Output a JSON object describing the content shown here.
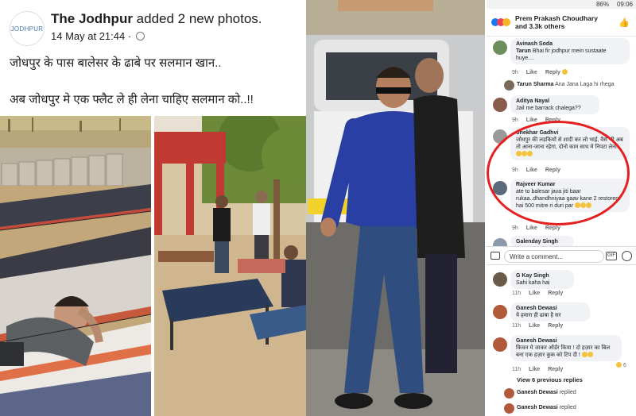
{
  "post": {
    "logo_text": "JODHPUR",
    "page_name": "The Jodhpur",
    "action": " added 2 new photos.",
    "date": "14 May at 21:44 ·",
    "line1": "जोधपुर के पास बालेसर के ढाबे पर सलमान खान..",
    "line2": "अब जोधपुर मे एक फ्लैट ले ही लेना चाहिए सलमान को..!!"
  },
  "status": {
    "battery": "86%",
    "time": "09:06"
  },
  "reactions": {
    "text": "Prem Prakash Choudhary and 3.3k others",
    "like_label": "✎"
  },
  "comments": [
    {
      "name": "Avinash Soda",
      "text": "",
      "time": "",
      "color": "#6b8e5a"
    },
    {
      "name": "Tarun",
      "text": "Bhai fir jodhpur mein sustaate huye....",
      "time": "9h",
      "color": "#7a6a5a"
    },
    {
      "name": "Aditya Nayal",
      "text": "Jail me barrack chalega??",
      "time": "9h",
      "color": "#8a5a4a"
    },
    {
      "name": "Shekhar Gadhvi",
      "text": "जोधपुर की लड़कियों से शादी कर लो भाई, वैसे भी अब तो आना-जाना रहेगा, दोनो काम साथ मे निपटा लेना।",
      "time": "9h",
      "color": "#9a9a9a"
    },
    {
      "name": "Rajveer Kumar",
      "text": "ate to balesar java jiti baar rukaa..dhandhniyaa gaav kane 2 restorent hai 500 mitre ri duri par",
      "time": "9h",
      "color": "#5a6a7a"
    },
    {
      "name": "Galenday Singh",
      "text": "",
      "time": "",
      "color": "#8a9aaa"
    },
    {
      "name": "G Kay Singh",
      "text": "Sahi kaha hai",
      "time": "11h",
      "color": "#6a5a4a"
    },
    {
      "name": "Ganesh Dewasi",
      "text": "ये हमारा ही ढाबा है सर",
      "time": "11h",
      "color": "#b05a3a"
    },
    {
      "name": "Ganesh Dewasi",
      "text": "किचन मे जाकर ऑर्डर किया ! दो हज़ार का बिल बना एक हज़ार कुक को टिप दी !",
      "time": "11h",
      "color": "#b05a3a"
    }
  ],
  "tarun_reply": {
    "name": "Tarun Sharma",
    "text": "Ana Jana Laga hi rhega"
  },
  "actions": {
    "like": "Like",
    "reply": "Reply"
  },
  "write_placeholder": "Write a comment...",
  "gif_label": "GIF",
  "view_previous": "View 6 previous replies",
  "replied_rows": [
    {
      "name": "Ganesh Dewasi",
      "text": " replied"
    },
    {
      "name": "Ganesh Dewasi",
      "text": " replied"
    }
  ],
  "reaction_counts": {
    "c1": "",
    "c9": "6"
  }
}
